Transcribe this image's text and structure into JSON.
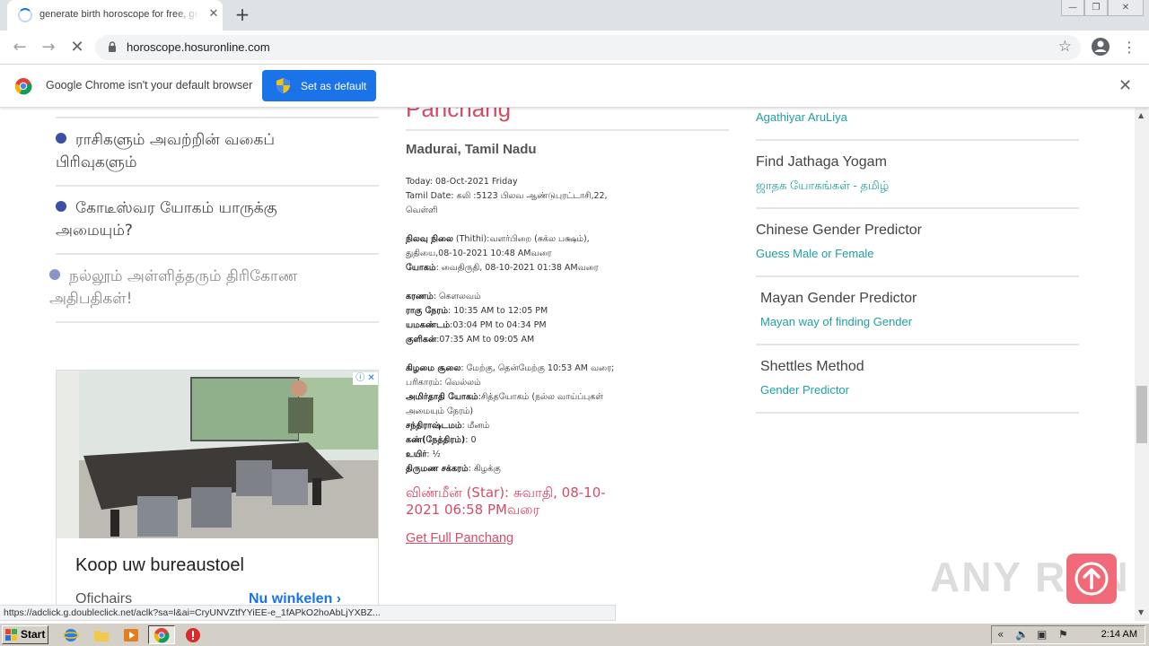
{
  "browser": {
    "tab_title": "generate birth horoscope for free, get",
    "tab_close": "✕",
    "new_tab": "+",
    "url": "horoscope.hosuronline.com",
    "window_controls": {
      "minimize": "—",
      "maximize": "❐",
      "close": "✕"
    }
  },
  "infobar": {
    "message": "Google Chrome isn't your default browser",
    "button": "Set as default",
    "close": "✕"
  },
  "left_column": {
    "items": [
      {
        "text": "ராசிகளும் அவற்றின் வகைப் பிரிவுகளும்"
      },
      {
        "text": "கோடீஸ்வர யோகம் யாருக்கு அமையும்?"
      },
      {
        "text": "நல்லூம் அள்ளித்தரும் திரிகோண அதிபதிகள்!"
      }
    ]
  },
  "ad": {
    "headline": "Koop uw bureaustoel",
    "advertiser": "Ofichairs",
    "cta": "Nu winkelen  ›",
    "adchoice": "ⓘ ✕"
  },
  "panchang": {
    "title": "Panchang",
    "location": "Madurai, Tamil Nadu",
    "today": "Today: 08-Oct-2021 Friday",
    "tamil_date": "Tamil Date: கலி :5123 பிலவ ஆண்டுபுரட்டாசி,22, வெள்ளி",
    "thithi_label": "நிலவு நிலை",
    "thithi_value": " (Thithi):வளர்பிறை (சுக்ல பக்ஷம்), துதியை,08-10-2021 10:48 AMவரை",
    "yogam_label": "யோகம்",
    "yogam_value": ": வைதிருதி, 08-10-2021 01:38 AMவரை",
    "karanam_label": "கரணம்",
    "karanam_value": ": கௌலவம்",
    "rahu_label": "ராகு நேரம்",
    "rahu_value": ": 10:35 AM to 12:05 PM",
    "yama_label": "யமகண்டம்",
    "yama_value": ":03:04 PM to 04:34 PM",
    "kuligai_label": "குளிகன்",
    "kuligai_value": ":07:35 AM to 09:05 AM",
    "soolai_label": "கிழமை சூலை",
    "soolai_value": ": மேற்கு, தென்மேற்கு 10:53 AM வரை; பரிகாரம்: வெல்லம்",
    "amirtha_label": "அமிர்தாதி யோகம்",
    "amirtha_value": ":சித்தயோகம் (நல்ல வாய்ப்புகள் அமையும் நேரம்)",
    "chandra_label": "சந்திராஷ்டமம்",
    "chandra_value": ": மீனம்",
    "kan_label": "கண்(நேத்திரம்)",
    "kan_value": ": 0",
    "uyir_label": "உயிர்",
    "uyir_value": ": ½",
    "chakra_label": "திருமண சக்கரம்",
    "chakra_value": ": கிழக்கு",
    "star": "விண்மீன் (Star): சுவாதி, 08-10-2021 06:58 PMவரை",
    "full_link": "Get Full Panchang"
  },
  "right_column": {
    "top_link": "Agathiyar AruLiya",
    "items": [
      {
        "title": "Find Jathaga Yogam",
        "link": "ஜாதக யோகங்கள் - தமிழ்"
      },
      {
        "title": "Chinese Gender Predictor",
        "link": "Guess Male or Female"
      },
      {
        "title": "Mayan Gender Predictor",
        "link": "Mayan way of finding Gender"
      },
      {
        "title": "Shettles Method",
        "link": "Gender Predictor"
      }
    ]
  },
  "status_url": "https://adclick.g.doubleclick.net/aclk?sa=l&ai=CryUNVZtfYYiEE-e_1fAPkO2hoAbLjYXBZ...",
  "watermark": "ANY RUN",
  "taskbar": {
    "start": "Start",
    "time": "2:14 AM"
  }
}
